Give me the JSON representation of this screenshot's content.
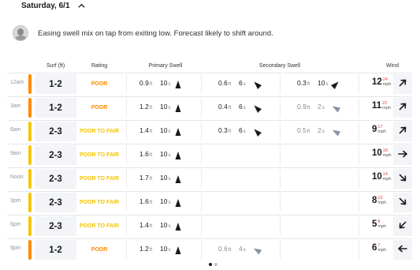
{
  "day": {
    "title": "Saturday, 6/1"
  },
  "note": {
    "text": "Easing swell mix on tap from exiting low. Forecast likely to shift around."
  },
  "headers": {
    "surf": "Surf (ft)",
    "rating": "Rating",
    "primary": "Primary Swell",
    "secondary": "Secondary Swell",
    "wind": "Wind"
  },
  "colors": {
    "poor": "#ff8a00",
    "poor_to_fair": "#f5c500",
    "gust": "#e04040"
  },
  "rows": [
    {
      "time": "12am",
      "surf": "1-2",
      "rating": "POOR",
      "rating_color": "#ff8a00",
      "p1": {
        "h": "0.9",
        "u": "ft",
        "p": "10",
        "pu": "s",
        "dir": 90
      },
      "s1": {
        "h": "0.6",
        "u": "ft",
        "p": "6",
        "pu": "s",
        "dir": 45
      },
      "s2": {
        "h": "0.3",
        "u": "ft",
        "p": "10",
        "pu": "s",
        "dir": 135,
        "faded": false
      },
      "wind": "12",
      "gust": "24",
      "wind_unit": "mph",
      "wind_dir": 45
    },
    {
      "time": "3am",
      "surf": "1-2",
      "rating": "POOR",
      "rating_color": "#ff8a00",
      "p1": {
        "h": "1.2",
        "u": "ft",
        "p": "10",
        "pu": "s",
        "dir": 90
      },
      "s1": {
        "h": "0.4",
        "u": "ft",
        "p": "6",
        "pu": "s",
        "dir": 45
      },
      "s2": {
        "h": "0.9",
        "u": "ft",
        "p": "2",
        "pu": "s",
        "dir": 30,
        "faded": true
      },
      "wind": "11",
      "gust": "22",
      "wind_unit": "mph",
      "wind_dir": 45
    },
    {
      "time": "6am",
      "surf": "2-3",
      "rating": "POOR TO FAIR",
      "rating_color": "#f5c500",
      "p1": {
        "h": "1.4",
        "u": "ft",
        "p": "10",
        "pu": "s",
        "dir": 90
      },
      "s1": {
        "h": "0.3",
        "u": "ft",
        "p": "6",
        "pu": "s",
        "dir": 45
      },
      "s2": {
        "h": "0.5",
        "u": "ft",
        "p": "2",
        "pu": "s",
        "dir": 30,
        "faded": true
      },
      "wind": "9",
      "gust": "17",
      "wind_unit": "mph",
      "wind_dir": 45
    },
    {
      "time": "9am",
      "surf": "2-3",
      "rating": "POOR TO FAIR",
      "rating_color": "#f5c500",
      "p1": {
        "h": "1.6",
        "u": "ft",
        "p": "10",
        "pu": "s",
        "dir": 90
      },
      "wind": "10",
      "gust": "18",
      "wind_unit": "mph",
      "wind_dir": 90
    },
    {
      "time": "Noon",
      "surf": "2-3",
      "rating": "POOR TO FAIR",
      "rating_color": "#f5c500",
      "p1": {
        "h": "1.7",
        "u": "ft",
        "p": "10",
        "pu": "s",
        "dir": 90
      },
      "wind": "10",
      "gust": "14",
      "wind_unit": "mph",
      "wind_dir": 135
    },
    {
      "time": "3pm",
      "surf": "2-3",
      "rating": "POOR TO FAIR",
      "rating_color": "#f5c500",
      "p1": {
        "h": "1.6",
        "u": "ft",
        "p": "10",
        "pu": "s",
        "dir": 90
      },
      "wind": "8",
      "gust": "10",
      "wind_unit": "mph",
      "wind_dir": 135
    },
    {
      "time": "6pm",
      "surf": "2-3",
      "rating": "POOR TO FAIR",
      "rating_color": "#f5c500",
      "p1": {
        "h": "1.4",
        "u": "ft",
        "p": "10",
        "pu": "s",
        "dir": 90
      },
      "wind": "5",
      "gust": "8",
      "wind_unit": "mph",
      "wind_dir": 225
    },
    {
      "time": "9pm",
      "surf": "1-2",
      "rating": "POOR",
      "rating_color": "#ff8a00",
      "p1": {
        "h": "1.2",
        "u": "ft",
        "p": "10",
        "pu": "s",
        "dir": 90
      },
      "s1": {
        "h": "0.6",
        "u": "ft",
        "p": "4",
        "pu": "s",
        "dir": 30,
        "faded": true
      },
      "wind": "6",
      "gust": "7",
      "wind_unit": "mph",
      "wind_dir": 270
    }
  ],
  "pagination": {
    "pages": 2,
    "current": 1
  }
}
